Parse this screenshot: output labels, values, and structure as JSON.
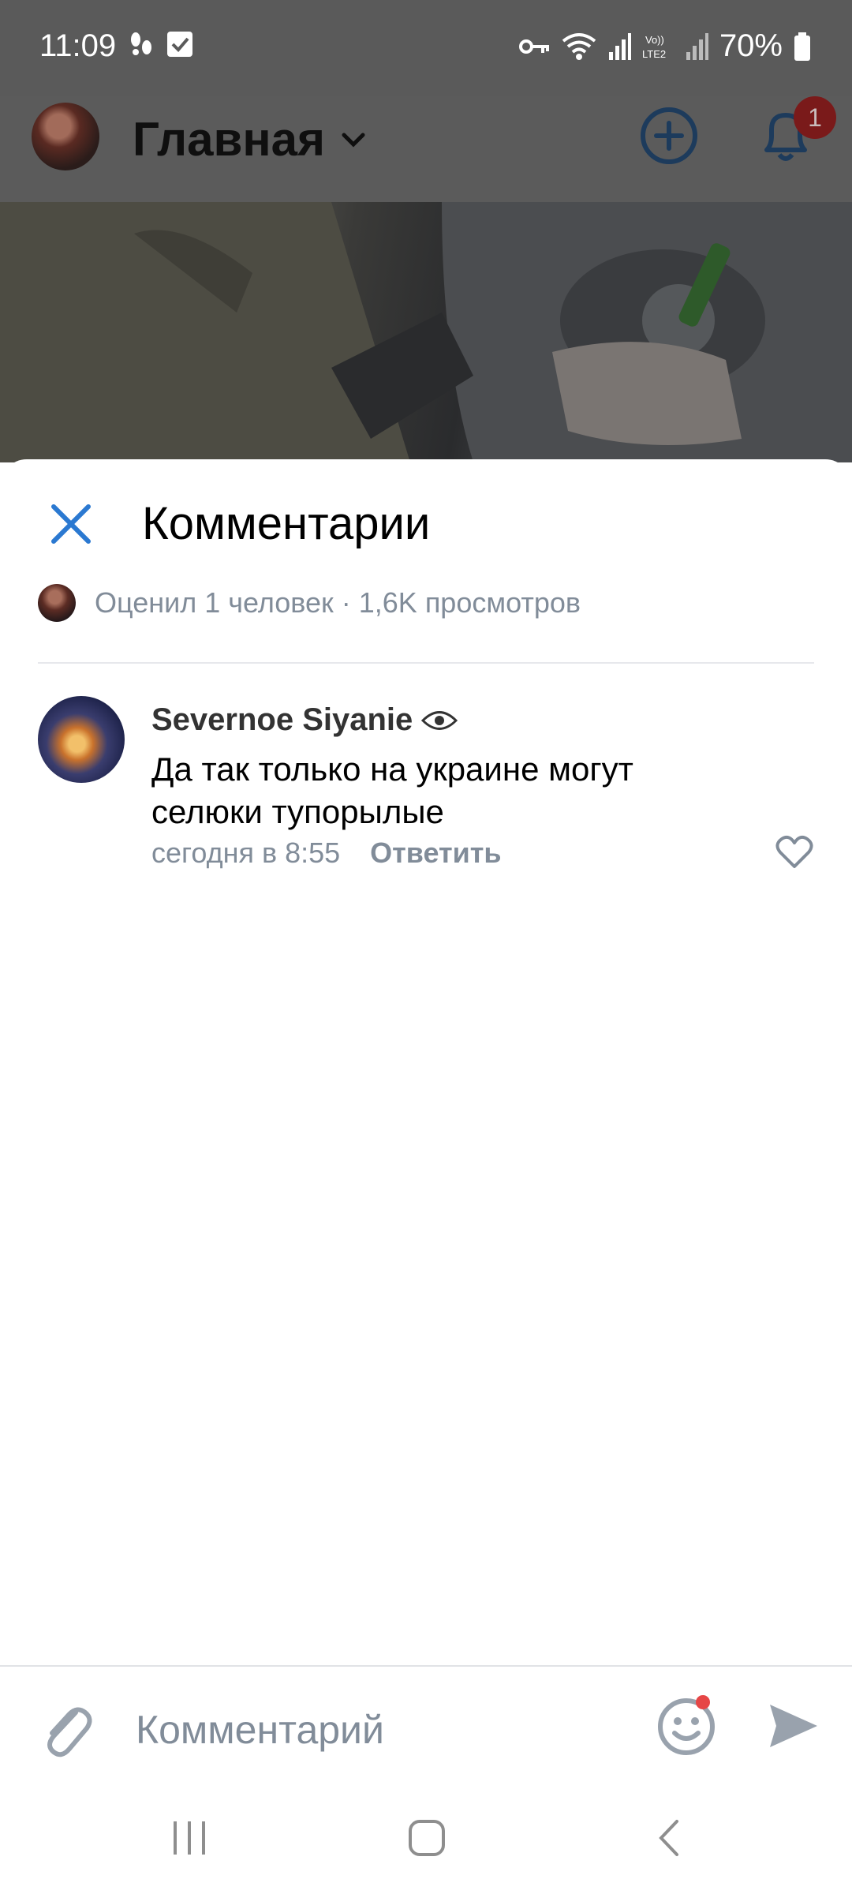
{
  "status_bar": {
    "time": "11:09",
    "battery": "70%"
  },
  "header": {
    "title": "Главная",
    "notification_count": "1"
  },
  "comments_sheet": {
    "title": "Комментарии",
    "likes_summary": "Оценил 1 человек · 1,6K просмотров",
    "comments": [
      {
        "author": "Severnoe Siyanie",
        "text": "Да так только на украине могут селюки тупорылые",
        "time": "сегодня в 8:55",
        "reply_label": "Ответить"
      }
    ]
  },
  "input_bar": {
    "placeholder": "Комментарий"
  },
  "colors": {
    "accent": "#2b79d1",
    "secondary_text": "#818c99",
    "badge": "#e64646"
  }
}
